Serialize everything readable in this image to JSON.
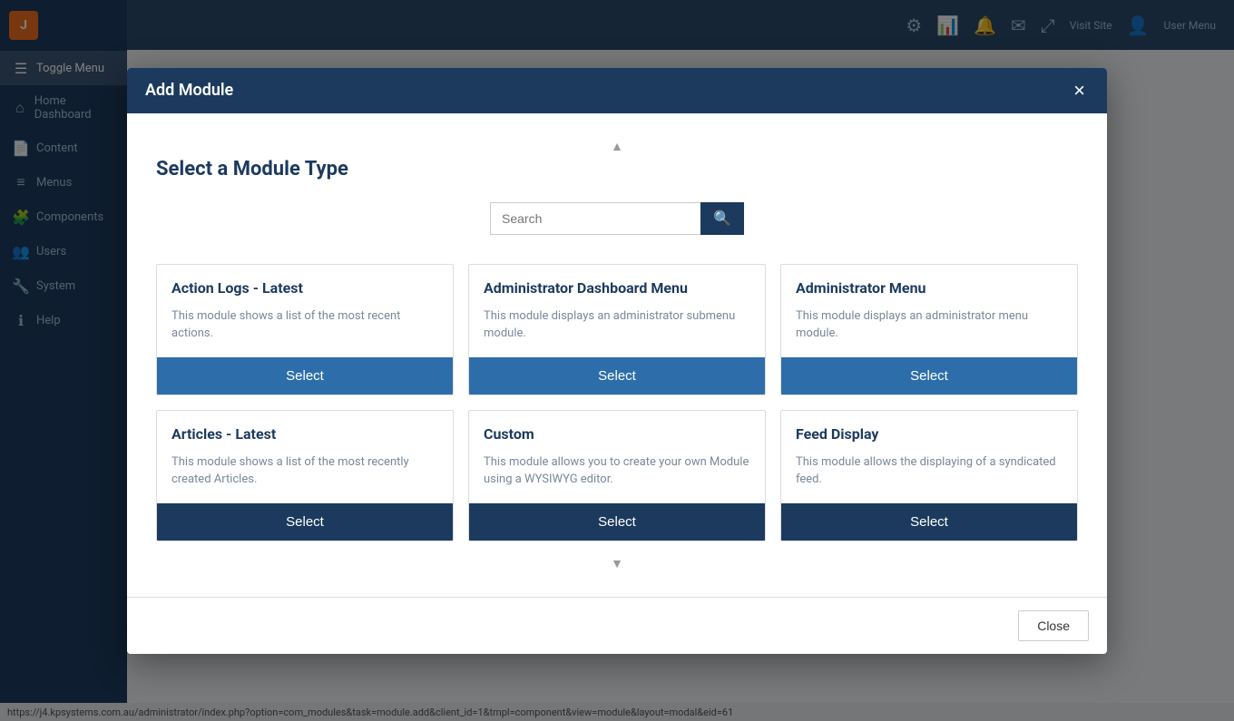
{
  "sidebar": {
    "logo_text": "J",
    "items": [
      {
        "id": "toggle-menu",
        "label": "Toggle Menu",
        "icon": "☰",
        "active": true
      },
      {
        "id": "home-dashboard",
        "label": "Home Dashboard",
        "icon": "⌂"
      },
      {
        "id": "content",
        "label": "Content",
        "icon": "📄"
      },
      {
        "id": "menus",
        "label": "Menus",
        "icon": "≡"
      },
      {
        "id": "components",
        "label": "Components",
        "icon": "🧩"
      },
      {
        "id": "users",
        "label": "Users",
        "icon": "👥"
      },
      {
        "id": "system",
        "label": "System",
        "icon": "🔧"
      },
      {
        "id": "help",
        "label": "Help",
        "icon": "ℹ"
      }
    ]
  },
  "topbar": {
    "items": [
      "Visit Site",
      "User Menu"
    ]
  },
  "modal": {
    "title": "Add Module",
    "close_label": "×",
    "section_title": "Select a Module Type",
    "search_placeholder": "Search",
    "search_button_icon": "🔍",
    "close_button_label": "Close",
    "scroll_up": "▲",
    "scroll_down": "▼",
    "modules": [
      {
        "id": "action-logs-latest",
        "title": "Action Logs - Latest",
        "description": "This module shows a list of the most recent actions.",
        "select_label": "Select",
        "dark_footer": false
      },
      {
        "id": "administrator-dashboard-menu",
        "title": "Administrator Dashboard Menu",
        "description": "This module displays an administrator submenu module.",
        "select_label": "Select",
        "dark_footer": false
      },
      {
        "id": "administrator-menu",
        "title": "Administrator Menu",
        "description": "This module displays an administrator menu module.",
        "select_label": "Select",
        "dark_footer": false
      },
      {
        "id": "articles-latest",
        "title": "Articles - Latest",
        "description": "This module shows a list of the most recently created Articles.",
        "select_label": "Select",
        "dark_footer": true
      },
      {
        "id": "custom",
        "title": "Custom",
        "description": "This module allows you to create your own Module using a WYSIWYG editor.",
        "select_label": "Select",
        "dark_footer": true
      },
      {
        "id": "feed-display",
        "title": "Feed Display",
        "description": "This module allows the displaying of a syndicated feed.",
        "select_label": "Select",
        "dark_footer": true
      }
    ]
  },
  "statusbar": {
    "url": "https://j4.kpsystems.com.au/administrator/index.php?option=com_modules&task=module.add&client_id=1&tmpl=component&view=module&layout=modal&eid=61"
  }
}
